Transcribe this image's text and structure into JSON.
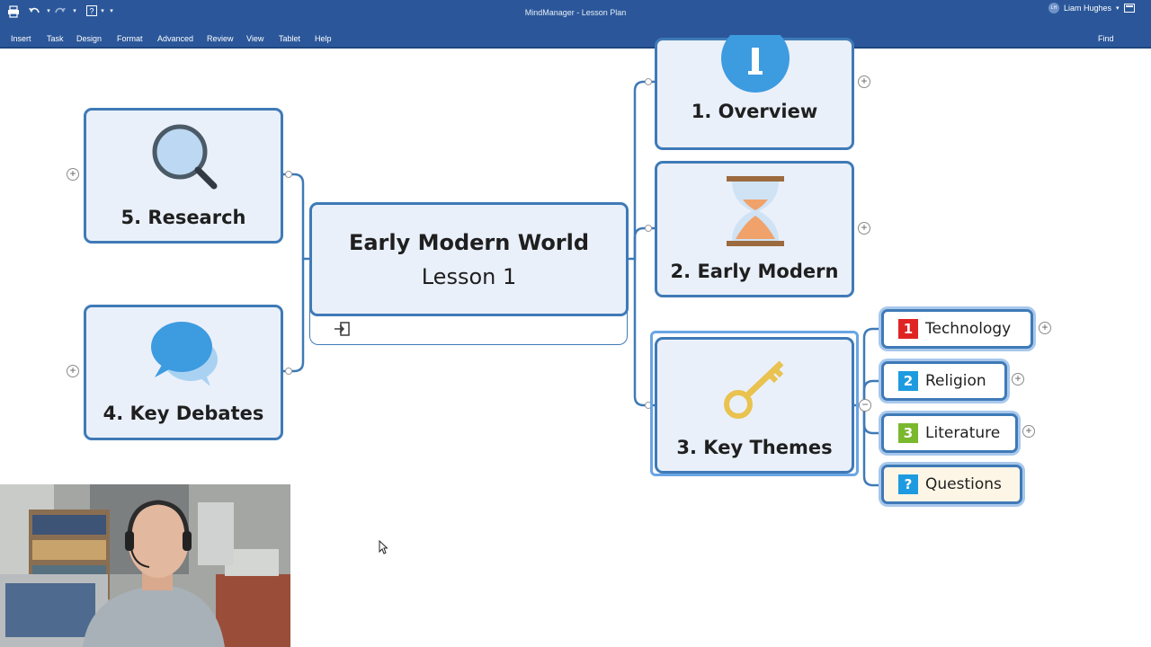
{
  "window": {
    "title": "MindManager - Lesson Plan",
    "user_name": "Liam Hughes",
    "user_initials": "LH",
    "find_label": "Find"
  },
  "menu": [
    "Insert",
    "Task",
    "Design",
    "Format",
    "Advanced",
    "Review",
    "View",
    "Tablet",
    "Help"
  ],
  "central_topic": {
    "title": "Early Modern World",
    "subtitle": "Lesson 1"
  },
  "topics": {
    "overview": "1. Overview",
    "early_modern": "2. Early Modern",
    "key_themes": "3. Key Themes",
    "key_debates": "4. Key Debates",
    "research": "5. Research"
  },
  "subtopics": [
    {
      "number": "1",
      "label": "Technology",
      "color": "#e02424"
    },
    {
      "number": "2",
      "label": "Religion",
      "color": "#1e9be0"
    },
    {
      "number": "3",
      "label": "Literature",
      "color": "#7ab82e"
    },
    {
      "number": "?",
      "label": "Questions",
      "color": "#1e9be0"
    }
  ],
  "icons": {
    "overview": "info-icon",
    "early_modern": "hourglass-icon",
    "key_themes": "key-icon",
    "key_debates": "speech-bubbles-icon",
    "research": "magnifier-icon",
    "central_note": "import-icon"
  },
  "colors": {
    "ribbon": "#2b579a",
    "topic_border": "#3f7ab7",
    "topic_fill": "#eaf0fa",
    "connector": "#3f7ab7"
  }
}
